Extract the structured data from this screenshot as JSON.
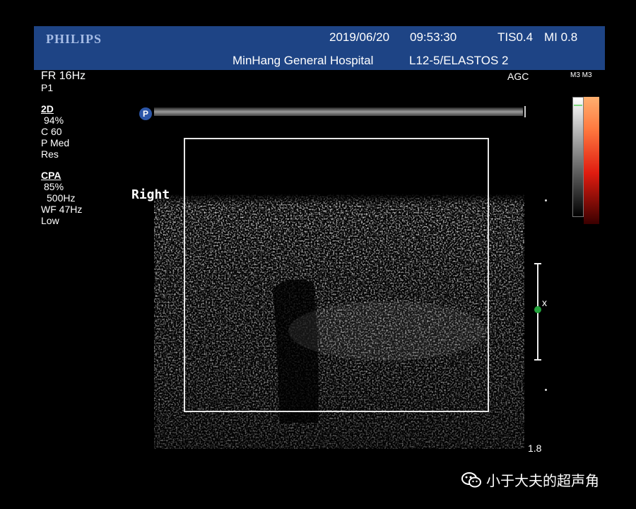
{
  "header": {
    "brand": "PHILIPS",
    "date": "2019/06/20",
    "time": "09:53:30",
    "tis": "TIS0.4",
    "mi": "MI 0.8",
    "hospital": "MinHang General Hospital",
    "probe": "L12-5/ELASTOS 2"
  },
  "left_panel": {
    "frame_rate": "FR 16Hz",
    "preset": "P1",
    "mode_2d": {
      "title": "2D",
      "gain": "94%",
      "compression": "C 60",
      "persistence": "P Med",
      "resolution": "Res"
    },
    "mode_cpa": {
      "title": "CPA",
      "gain": "85%",
      "prf": "500Hz",
      "wall_filter": "WF 47Hz",
      "sensitivity": "Low"
    }
  },
  "agc": "AGC",
  "color_map_label": "M3 M3",
  "body_marker": "Right",
  "probe_icon": "P",
  "depth": "1.8",
  "focus_marker": "x",
  "watermark": "小于大夫的超声角",
  "icons": {
    "probe": "probe-icon",
    "focus": "focus-marker-icon",
    "watermark": "wechat-icon"
  }
}
